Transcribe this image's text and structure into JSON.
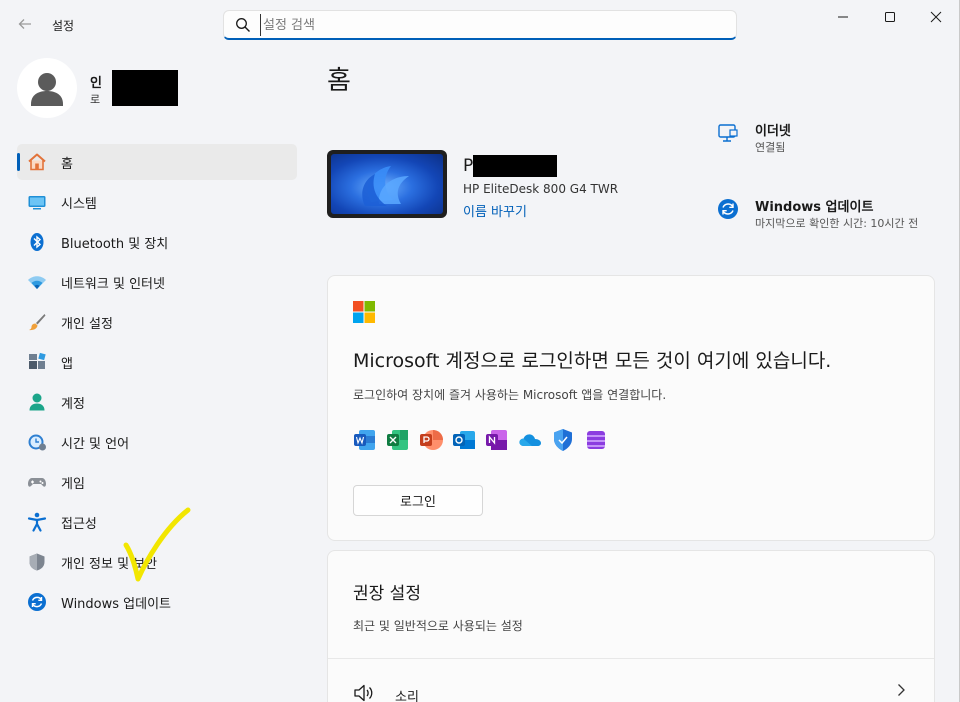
{
  "window": {
    "title": "설정",
    "controls": {
      "minimize": "—",
      "maximize": "☐",
      "close": "✕"
    }
  },
  "search": {
    "placeholder": "설정 검색",
    "value": ""
  },
  "profile": {
    "name": "인",
    "sub": "로"
  },
  "sidebar": {
    "items": [
      {
        "label": "홈",
        "icon": "home-icon",
        "active": true
      },
      {
        "label": "시스템",
        "icon": "system-icon"
      },
      {
        "label": "Bluetooth 및 장치",
        "icon": "bluetooth-icon"
      },
      {
        "label": "네트워크 및 인터넷",
        "icon": "wifi-icon"
      },
      {
        "label": "개인 설정",
        "icon": "brush-icon"
      },
      {
        "label": "앱",
        "icon": "apps-icon"
      },
      {
        "label": "계정",
        "icon": "account-icon"
      },
      {
        "label": "시간 및 언어",
        "icon": "clock-globe-icon"
      },
      {
        "label": "게임",
        "icon": "gamepad-icon"
      },
      {
        "label": "접근성",
        "icon": "accessibility-icon"
      },
      {
        "label": "개인 정보 및 보안",
        "icon": "shield-icon"
      },
      {
        "label": "Windows 업데이트",
        "icon": "update-icon"
      }
    ]
  },
  "main": {
    "title": "홈",
    "device": {
      "name": "P",
      "model": "HP EliteDesk 800 G4 TWR",
      "rename": "이름 바꾸기"
    },
    "status": {
      "ethernet": {
        "title": "이더넷",
        "sub": "연결됨"
      },
      "update": {
        "title": "Windows 업데이트",
        "sub": "마지막으로 확인한 시간: 10시간 전"
      }
    },
    "ms_card": {
      "heading": "Microsoft 계정으로 로그인하면 모든 것이 여기에 있습니다.",
      "desc": "로그인하여 장치에 즐겨 사용하는 Microsoft 앱을 연결합니다.",
      "login": "로그인",
      "apps": [
        "word-icon",
        "excel-icon",
        "powerpoint-icon",
        "outlook-icon",
        "onenote-icon",
        "onedrive-icon",
        "defender-icon",
        "clipchamp-icon"
      ]
    },
    "recommended": {
      "title": "권장 설정",
      "desc": "최근 및 일반적으로 사용되는 설정",
      "rows": [
        {
          "label": "소리",
          "icon": "speaker-icon"
        }
      ]
    }
  },
  "colors": {
    "accent": "#005fb8",
    "sidebar_active_bg": "#eaeaea",
    "window_bg": "#f3f4f7",
    "annotation_check": "#f2e600"
  }
}
